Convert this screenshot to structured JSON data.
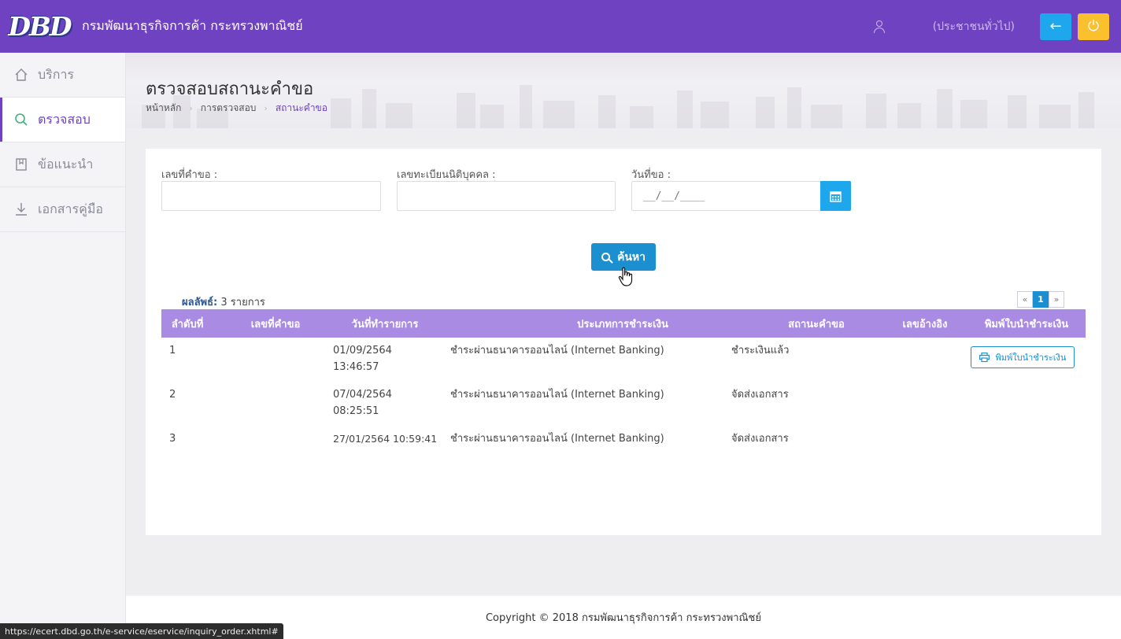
{
  "header": {
    "logo_text": "DBD",
    "title": "กรมพัฒนาธุรกิจการค้า กระทรวงพาณิชย์",
    "user_label": "(ประชาชนทั่วไป)",
    "back_icon": "←",
    "power_icon": "⏻",
    "colors": {
      "bar": "#6f42c1",
      "back": "#1ea7ec",
      "power": "#fbc02d"
    }
  },
  "sidebar": {
    "items": [
      {
        "label": "บริการ",
        "icon": "home-icon",
        "glyph": "⌂",
        "active": false
      },
      {
        "label": "ตรวจสอบ",
        "icon": "search-icon",
        "glyph": "🔍︎",
        "active": true
      },
      {
        "label": "ข้อแนะนำ",
        "icon": "book-icon",
        "glyph": "▯",
        "active": false
      },
      {
        "label": "เอกสารคู่มือ",
        "icon": "download-icon",
        "glyph": "↓",
        "active": false
      }
    ]
  },
  "page": {
    "title": "ตรวจสอบสถานะคำขอ",
    "breadcrumb": [
      "หน้าหลัก",
      "การตรวจสอบ",
      "สถานะคำขอ"
    ],
    "breadcrumb_sep": "›"
  },
  "form": {
    "request_no_label": "เลขที่คำขอ :",
    "request_no_value": "",
    "reg_no_label": "เลขทะเบียนนิติบุคคล :",
    "reg_no_value": "",
    "date_label": "วันที่ขอ :",
    "date_value": "__/__/____",
    "search_label": "ค้นหา"
  },
  "results": {
    "count_label": "ผลลัพธ์:",
    "count_text": "3 รายการ",
    "pager": {
      "prev": "«",
      "current": "1",
      "next": "»"
    },
    "columns": [
      "ลำดับที่",
      "เลขที่คำขอ",
      "วันที่ทำรายการ",
      "ประเภทการชำระเงิน",
      "สถานะคำขอ",
      "เลขอ้างอิง",
      "พิมพ์ใบนำชำระเงิน"
    ],
    "rows": [
      {
        "seq": "1",
        "request_no": "",
        "date": "01/09/2564",
        "time": "13:46:57",
        "payment": "ชำระผ่านธนาคารออนไลน์ (Internet Banking)",
        "status": "ชำระเงินแล้ว",
        "ref": "",
        "print_label": "พิมพ์ใบนำชำระเงิน"
      },
      {
        "seq": "2",
        "request_no": "",
        "date": "07/04/2564",
        "time": "08:25:51",
        "payment": "ชำระผ่านธนาคารออนไลน์ (Internet Banking)",
        "status": "จัดส่งเอกสาร",
        "ref": "",
        "print_label": ""
      },
      {
        "seq": "3",
        "request_no": "",
        "date": "27/01/2564 10:59:41",
        "time": "",
        "payment": "ชำระผ่านธนาคารออนไลน์ (Internet Banking)",
        "status": "จัดส่งเอกสาร",
        "ref": "",
        "print_label": ""
      }
    ]
  },
  "footer": {
    "copyright": "Copyright © 2018 กรมพัฒนาธุรกิจการค้า กระทรวงพาณิชย์"
  },
  "statusbar": {
    "url": "https://ecert.dbd.go.th/e-service/eservice/inquiry_order.xhtml#"
  }
}
